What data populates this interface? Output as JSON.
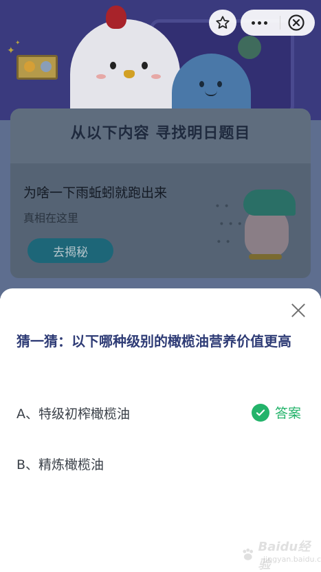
{
  "header": {
    "star_icon": "star-outline-icon",
    "more_icon": "more-dots-icon",
    "close_icon": "close-circle-icon"
  },
  "banner": {
    "title": "从以下内容 寻找明日题目"
  },
  "question_card": {
    "title": "为啥一下雨蚯蚓就跑出来",
    "subtitle": "真相在这里",
    "reveal_button": "去揭秘"
  },
  "sheet": {
    "title": "猜一猜：以下哪种级别的橄榄油营养价值更高",
    "options": [
      {
        "label": "A、特级初榨橄榄油",
        "is_answer": true
      },
      {
        "label": "B、精炼橄榄油",
        "is_answer": false
      }
    ],
    "answer_label": "答案"
  },
  "watermark": {
    "text": "Baidu经验",
    "sub": "jingyan.baidu.com"
  },
  "colors": {
    "title_blue": "#2f3c76",
    "answer_green": "#23b36a",
    "button_teal": "#1d6678"
  }
}
